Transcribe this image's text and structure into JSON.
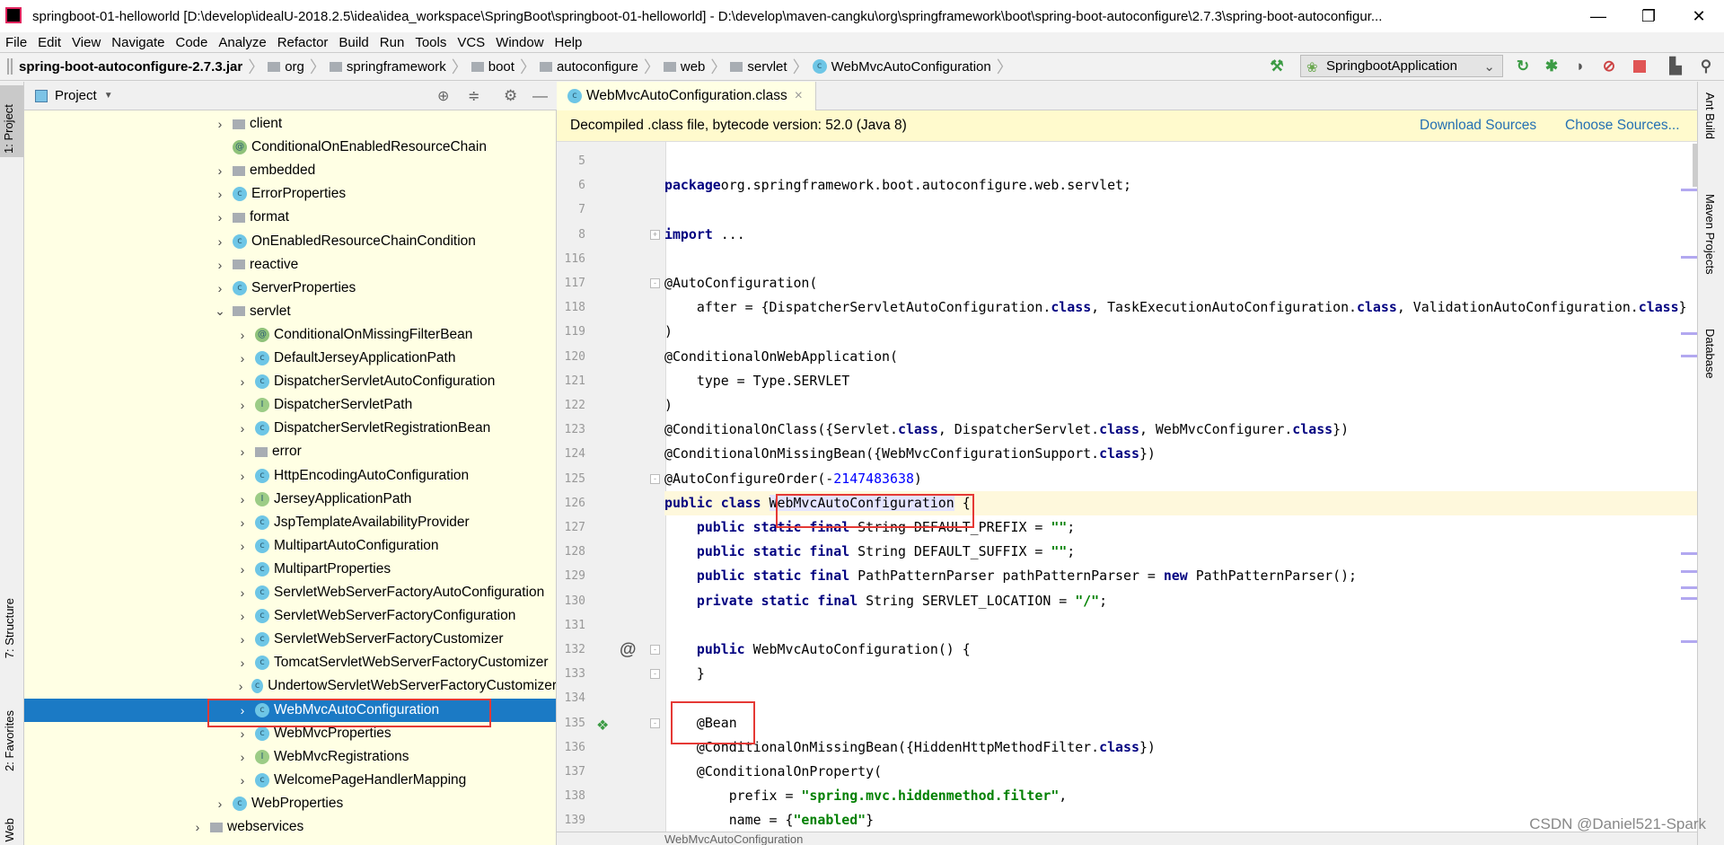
{
  "window": {
    "title": "springboot-01-helloworld [D:\\develop\\idealU-2018.2.5\\idea\\idea_workspace\\SpringBoot\\springboot-01-helloworld] - D:\\develop\\maven-cangku\\org\\springframework\\boot\\spring-boot-autoconfigure\\2.7.3\\spring-boot-autoconfigur..."
  },
  "menu": [
    "File",
    "Edit",
    "View",
    "Navigate",
    "Code",
    "Analyze",
    "Refactor",
    "Build",
    "Run",
    "Tools",
    "VCS",
    "Window",
    "Help"
  ],
  "breadcrumb": [
    {
      "label": "spring-boot-autoconfigure-2.7.3.jar",
      "icon": "jar-icon"
    },
    {
      "label": "org",
      "icon": "folder-icon"
    },
    {
      "label": "springframework",
      "icon": "folder-icon"
    },
    {
      "label": "boot",
      "icon": "folder-icon"
    },
    {
      "label": "autoconfigure",
      "icon": "folder-icon"
    },
    {
      "label": "web",
      "icon": "folder-icon"
    },
    {
      "label": "servlet",
      "icon": "folder-icon"
    },
    {
      "label": "WebMvcAutoConfiguration",
      "icon": "class-icon"
    }
  ],
  "toolbar": {
    "run_config": "SpringbootApplication",
    "accent_run": "#3b9b44",
    "stop_color": "#e05555"
  },
  "left_strip": {
    "project": "1: Project",
    "structure": "7: Structure",
    "favorites": "2: Favorites",
    "web": "Web"
  },
  "right_strip": {
    "ant": "Ant Build",
    "maven": "Maven Projects",
    "database": "Database"
  },
  "project_panel": {
    "title": "Project"
  },
  "tree": [
    {
      "label": "client",
      "type": "folder",
      "level": 0,
      "arrow": "›"
    },
    {
      "label": "ConditionalOnEnabledResourceChain",
      "type": "annotation",
      "level": 0,
      "arrow": ""
    },
    {
      "label": "embedded",
      "type": "folder",
      "level": 0,
      "arrow": "›"
    },
    {
      "label": "ErrorProperties",
      "type": "class",
      "level": 0,
      "arrow": "›"
    },
    {
      "label": "format",
      "type": "folder",
      "level": 0,
      "arrow": "›"
    },
    {
      "label": "OnEnabledResourceChainCondition",
      "type": "class",
      "level": 0,
      "arrow": "›"
    },
    {
      "label": "reactive",
      "type": "folder",
      "level": 0,
      "arrow": "›"
    },
    {
      "label": "ServerProperties",
      "type": "class",
      "level": 0,
      "arrow": "›"
    },
    {
      "label": "servlet",
      "type": "folder",
      "level": 0,
      "arrow": "⌄"
    },
    {
      "label": "ConditionalOnMissingFilterBean",
      "type": "annotation",
      "level": 1,
      "arrow": "›"
    },
    {
      "label": "DefaultJerseyApplicationPath",
      "type": "class",
      "level": 1,
      "arrow": "›"
    },
    {
      "label": "DispatcherServletAutoConfiguration",
      "type": "class",
      "level": 1,
      "arrow": "›"
    },
    {
      "label": "DispatcherServletPath",
      "type": "interface",
      "level": 1,
      "arrow": "›"
    },
    {
      "label": "DispatcherServletRegistrationBean",
      "type": "class",
      "level": 1,
      "arrow": "›"
    },
    {
      "label": "error",
      "type": "folder",
      "level": 1,
      "arrow": "›"
    },
    {
      "label": "HttpEncodingAutoConfiguration",
      "type": "class",
      "level": 1,
      "arrow": "›"
    },
    {
      "label": "JerseyApplicationPath",
      "type": "interface",
      "level": 1,
      "arrow": "›"
    },
    {
      "label": "JspTemplateAvailabilityProvider",
      "type": "class",
      "level": 1,
      "arrow": "›"
    },
    {
      "label": "MultipartAutoConfiguration",
      "type": "class",
      "level": 1,
      "arrow": "›"
    },
    {
      "label": "MultipartProperties",
      "type": "class",
      "level": 1,
      "arrow": "›"
    },
    {
      "label": "ServletWebServerFactoryAutoConfiguration",
      "type": "class",
      "level": 1,
      "arrow": "›"
    },
    {
      "label": "ServletWebServerFactoryConfiguration",
      "type": "class",
      "level": 1,
      "arrow": "›"
    },
    {
      "label": "ServletWebServerFactoryCustomizer",
      "type": "class",
      "level": 1,
      "arrow": "›"
    },
    {
      "label": "TomcatServletWebServerFactoryCustomizer",
      "type": "class",
      "level": 1,
      "arrow": "›"
    },
    {
      "label": "UndertowServletWebServerFactoryCustomizer",
      "type": "class",
      "level": 1,
      "arrow": "›"
    },
    {
      "label": "WebMvcAutoConfiguration",
      "type": "class",
      "level": 1,
      "arrow": "›",
      "selected": true
    },
    {
      "label": "WebMvcProperties",
      "type": "class",
      "level": 1,
      "arrow": "›"
    },
    {
      "label": "WebMvcRegistrations",
      "type": "interface",
      "level": 1,
      "arrow": "›"
    },
    {
      "label": "WelcomePageHandlerMapping",
      "type": "class",
      "level": 1,
      "arrow": "›"
    },
    {
      "label": "WebProperties",
      "type": "class",
      "level": 0,
      "arrow": "›"
    },
    {
      "label": "webservices",
      "type": "folder",
      "level": -1,
      "arrow": "›"
    }
  ],
  "editor": {
    "tab": "WebMvcAutoConfiguration.class",
    "banner": "Decompiled .class file, bytecode version: 52.0 (Java 8)",
    "download_sources": "Download Sources",
    "choose_sources": "Choose Sources...",
    "status_crumb": "WebMvcAutoConfiguration",
    "lines": [
      {
        "n": "5",
        "t": []
      },
      {
        "n": "6",
        "t": [
          [
            "kw",
            "package"
          ],
          [
            "",
            "org.springframework.boot.autoconfigure.web.servlet;"
          ]
        ]
      },
      {
        "n": "7",
        "t": []
      },
      {
        "n": "8",
        "t": [
          [
            "kw",
            "import"
          ],
          [
            "",
            " ..."
          ]
        ]
      },
      {
        "n": "116",
        "t": []
      },
      {
        "n": "117",
        "t": [
          [
            "",
            "@AutoConfiguration("
          ]
        ]
      },
      {
        "n": "118",
        "t": [
          [
            "",
            "    after = {DispatcherServletAutoConfiguration."
          ],
          [
            "kw",
            "class"
          ],
          [
            "",
            ", TaskExecutionAutoConfiguration."
          ],
          [
            "kw",
            "class"
          ],
          [
            "",
            ", ValidationAutoConfiguration."
          ],
          [
            "kw",
            "class"
          ],
          [
            "",
            "}"
          ]
        ]
      },
      {
        "n": "119",
        "t": [
          [
            "",
            ")"
          ]
        ]
      },
      {
        "n": "120",
        "t": [
          [
            "",
            "@ConditionalOnWebApplication("
          ]
        ]
      },
      {
        "n": "121",
        "t": [
          [
            "",
            "    type = Type.SERVLET"
          ]
        ]
      },
      {
        "n": "122",
        "t": [
          [
            "",
            ")"
          ]
        ]
      },
      {
        "n": "123",
        "t": [
          [
            "",
            "@ConditionalOnClass({Servlet."
          ],
          [
            "kw",
            "class"
          ],
          [
            "",
            ", DispatcherServlet."
          ],
          [
            "kw",
            "class"
          ],
          [
            "",
            ", WebMvcConfigurer."
          ],
          [
            "kw",
            "class"
          ],
          [
            "",
            "})"
          ]
        ]
      },
      {
        "n": "124",
        "t": [
          [
            "",
            "@ConditionalOnMissingBean({WebMvcConfigurationSupport."
          ],
          [
            "kw",
            "class"
          ],
          [
            "",
            "})"
          ]
        ]
      },
      {
        "n": "125",
        "t": [
          [
            "",
            "@AutoConfigureOrder(-"
          ],
          [
            "num",
            "2147483638"
          ],
          [
            "",
            ")"
          ]
        ]
      },
      {
        "n": "126",
        "t": [
          [
            "kw",
            "public class "
          ],
          [
            "",
            "WebMvcAutoConfiguration {"
          ]
        ],
        "current": true
      },
      {
        "n": "127",
        "t": [
          [
            "kw",
            "    public static final "
          ],
          [
            "",
            "String DEFAULT_PREFIX = "
          ],
          [
            "str",
            "\"\""
          ],
          [
            "",
            ";"
          ]
        ]
      },
      {
        "n": "128",
        "t": [
          [
            "kw",
            "    public static final "
          ],
          [
            "",
            "String DEFAULT_SUFFIX = "
          ],
          [
            "str",
            "\"\""
          ],
          [
            "",
            ";"
          ]
        ]
      },
      {
        "n": "129",
        "t": [
          [
            "kw",
            "    public static final "
          ],
          [
            "",
            "PathPatternParser pathPatternParser = "
          ],
          [
            "kw",
            "new "
          ],
          [
            "",
            "PathPatternParser();"
          ]
        ]
      },
      {
        "n": "130",
        "t": [
          [
            "kw",
            "    private static final "
          ],
          [
            "",
            "String SERVLET_LOCATION = "
          ],
          [
            "str",
            "\"/\""
          ],
          [
            "",
            ";"
          ]
        ]
      },
      {
        "n": "131",
        "t": []
      },
      {
        "n": "132",
        "t": [
          [
            "kw",
            "    public "
          ],
          [
            "",
            "WebMvcAutoConfiguration() {"
          ]
        ]
      },
      {
        "n": "133",
        "t": [
          [
            "",
            "    }"
          ]
        ]
      },
      {
        "n": "134",
        "t": []
      },
      {
        "n": "135",
        "t": [
          [
            "",
            "    @Bean"
          ]
        ]
      },
      {
        "n": "136",
        "t": [
          [
            "",
            "    @ConditionalOnMissingBean({HiddenHttpMethodFilter."
          ],
          [
            "kw",
            "class"
          ],
          [
            "",
            "})"
          ]
        ]
      },
      {
        "n": "137",
        "t": [
          [
            "",
            "    @ConditionalOnProperty("
          ]
        ]
      },
      {
        "n": "138",
        "t": [
          [
            "",
            "        prefix = "
          ],
          [
            "str",
            "\"spring.mvc.hiddenmethod.filter\""
          ],
          [
            "",
            ","
          ]
        ]
      },
      {
        "n": "139",
        "t": [
          [
            "",
            "        name = {"
          ],
          [
            "str",
            "\"enabled\""
          ],
          [
            "",
            "}"
          ]
        ]
      }
    ]
  },
  "watermark": "CSDN @Daniel521-Spark"
}
